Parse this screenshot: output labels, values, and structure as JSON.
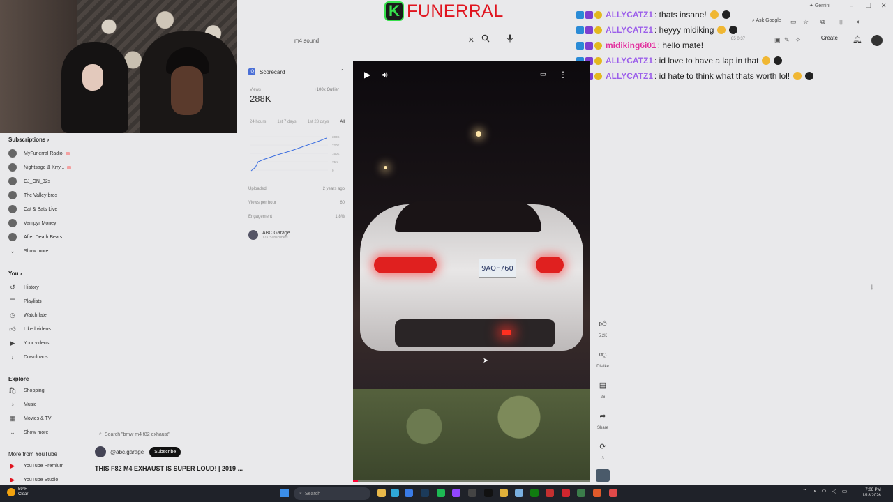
{
  "brand": {
    "letter": "K",
    "name": "FUNERRAL"
  },
  "search": {
    "value": "m4 sound",
    "clear_icon": "close-icon",
    "search_icon": "search-icon",
    "mic_icon": "mic-icon"
  },
  "chat": [
    {
      "user": "ALLYCATZ1",
      "text": ": thats insane!",
      "style": "purple"
    },
    {
      "user": "ALLYCATZ1",
      "text": ": heyyy midiking",
      "style": "purple"
    },
    {
      "user": "midiking6i01",
      "text": ": hello mate!",
      "style": "pink"
    },
    {
      "user": "ALLYCATZ1",
      "text": ": id love to have a lap in that",
      "style": "purple"
    },
    {
      "user": "ALLYCATZ1",
      "text": ": id hate to think what thats worth lol!",
      "style": "purple"
    }
  ],
  "browser": {
    "gemini": "Gemini",
    "ask_google": "Ask Google",
    "create": "Create",
    "mini_stats": "85  0  37"
  },
  "sidebar": {
    "subscriptions_title": "Subscriptions",
    "subscriptions": [
      {
        "label": "MyFunerral Radio",
        "live": true
      },
      {
        "label": "Nightsage & Krry...",
        "live": true
      },
      {
        "label": "CJ_ON_32s",
        "live": false
      },
      {
        "label": "The Valley bros",
        "live": false
      },
      {
        "label": "Cat & Bats Live",
        "live": false
      },
      {
        "label": "Vampyr Money",
        "live": false
      },
      {
        "label": "After Death Beats",
        "live": false
      }
    ],
    "show_more": "Show more",
    "you_title": "You",
    "you_items": [
      "History",
      "Playlists",
      "Watch later",
      "Liked videos",
      "Your videos",
      "Downloads"
    ],
    "explore_title": "Explore",
    "explore_items": [
      "Shopping",
      "Music",
      "Movies & TV"
    ],
    "show_more2": "Show more",
    "more_title": "More from YouTube",
    "more_items": [
      "YouTube Premium",
      "YouTube Studio"
    ]
  },
  "scorecard": {
    "title": "Scorecard",
    "views_label": "Views",
    "views": "288K",
    "outlier": "+100x Outlier",
    "ranges": [
      "24 hours",
      "1st 7 days",
      "1st 28 days",
      "All"
    ],
    "selected_range": "All",
    "chart_ticks": [
      "300K",
      "220K",
      "150K",
      "75K",
      "0"
    ],
    "rows": [
      {
        "label": "Uploaded",
        "value": "2 years ago"
      },
      {
        "label": "Views per hour",
        "value": "60"
      },
      {
        "label": "Engagement",
        "value": "1.8%"
      }
    ],
    "channel_name": "ABC Garage",
    "channel_subs": "17K Subscribers"
  },
  "lower": {
    "mini_search": "Search \"bmw m4 f82 exhaust\"",
    "handle": "@abc.garage",
    "subscribe": "Subscribe",
    "video_title": "THIS F82 M4 EXHAUST IS SUPER LOUD! | 2019 ..."
  },
  "video": {
    "plate": "9AOF760",
    "progress": 0.02
  },
  "rail": {
    "likes": "5.2K",
    "dislike": "Dislike",
    "comments": "26",
    "share": "Share",
    "remix": "3"
  },
  "taskbar": {
    "weather_temp": "59°F",
    "weather_desc": "Clear",
    "search_placeholder": "Search",
    "time": "7:06 PM",
    "date": "1/18/2026"
  }
}
